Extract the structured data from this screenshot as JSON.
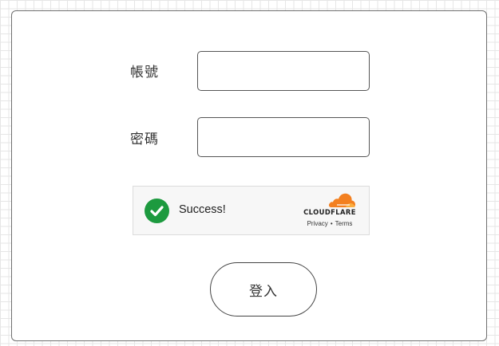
{
  "form": {
    "account_label": "帳號",
    "account_value": "",
    "password_label": "密碼",
    "password_value": "",
    "login_label": "登入"
  },
  "captcha": {
    "status_text": "Success!",
    "brand": "CLOUDFLARE",
    "privacy_label": "Privacy",
    "separator": "•",
    "terms_label": "Terms",
    "check_icon": "checkmark-circle-icon",
    "logo_icon": "cloudflare-cloud-icon",
    "colors": {
      "success": "#1d9a3f",
      "brand_orange": "#f38020",
      "brand_light_orange": "#faad3f"
    }
  }
}
